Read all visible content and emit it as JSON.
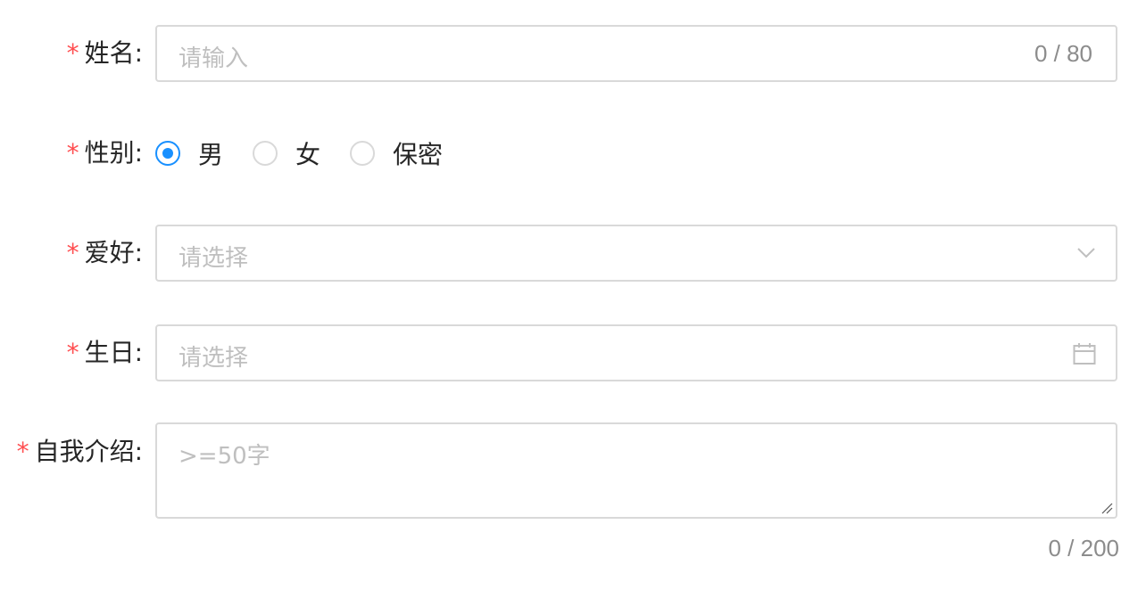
{
  "form": {
    "name": {
      "required_mark": "*",
      "label": "姓名:",
      "placeholder": "请输入",
      "counter": "0 / 80"
    },
    "gender": {
      "required_mark": "*",
      "label": "性别:",
      "options": [
        {
          "label": "男",
          "checked": true
        },
        {
          "label": "女",
          "checked": false
        },
        {
          "label": "保密",
          "checked": false
        }
      ]
    },
    "hobby": {
      "required_mark": "*",
      "label": "爱好:",
      "placeholder": "请选择",
      "icon": "chevron-down-icon"
    },
    "birthday": {
      "required_mark": "*",
      "label": "生日:",
      "placeholder": "请选择",
      "icon": "calendar-icon"
    },
    "intro": {
      "required_mark": "*",
      "label": "自我介绍:",
      "placeholder": ">=50字",
      "counter": "0 / 200"
    }
  },
  "colors": {
    "required": "#ff4d4f",
    "primary": "#1890ff",
    "border": "#d9d9d9",
    "placeholder": "#bfbfbf",
    "counter": "#8c8c8c"
  }
}
